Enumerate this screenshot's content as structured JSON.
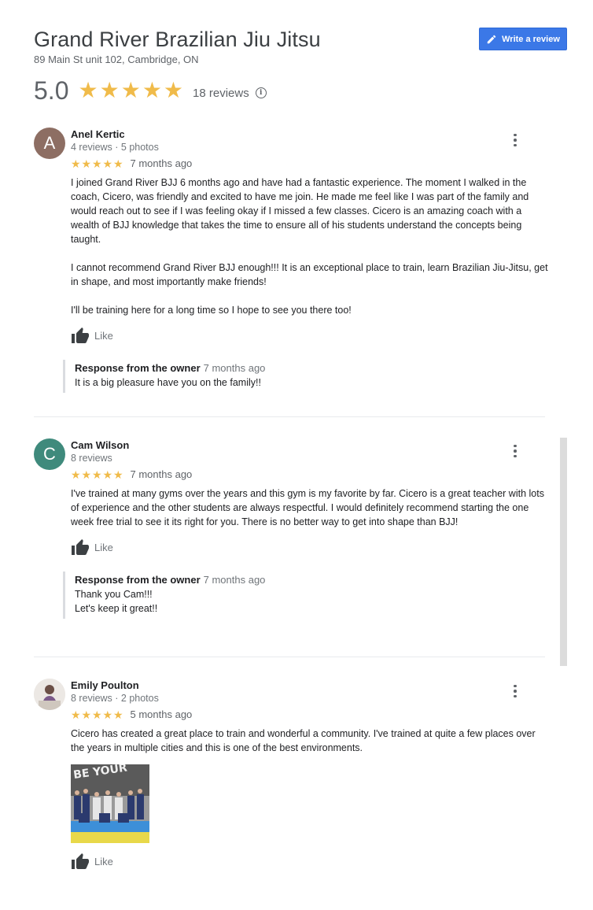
{
  "business": {
    "name": "Grand River Brazilian Jiu Jitsu",
    "address": "89 Main St unit 102, Cambridge, ON",
    "rating": "5.0",
    "review_count": "18 reviews",
    "write_review_label": "Write a review"
  },
  "colors": {
    "accent": "#3b78e7",
    "star": "#f0bb4a"
  },
  "reviews": [
    {
      "avatar_letter": "A",
      "avatar_color": "#8d6e63",
      "name": "Anel Kertic",
      "meta": "4 reviews · 5 photos",
      "stars": 5,
      "time": "7 months ago",
      "paragraphs": [
        "I joined Grand River BJJ 6 months ago and have had a fantastic experience. The moment I walked in the coach, Cicero, was friendly and excited to have me join. He made me feel like I was part of the family and would reach out to see if I was feeling okay if I missed a few classes. Cicero is an amazing coach with a wealth of BJJ knowledge that takes the time to ensure all of his students understand the concepts being taught.",
        "I cannot recommend Grand River BJJ enough!!! It is an exceptional place to train, learn Brazilian Jiu-Jitsu, get in shape, and most importantly make friends!",
        "I'll be training here for a long time so I hope to see you there too!"
      ],
      "like_label": "Like",
      "owner_label": "Response from the owner",
      "owner_time": "7 months ago",
      "owner_text": "It is a big pleasure have you on the family!!"
    },
    {
      "avatar_letter": "C",
      "avatar_color": "#3f8a7c",
      "name": "Cam Wilson",
      "meta": "8 reviews",
      "stars": 5,
      "time": "7 months ago",
      "paragraphs": [
        "I've trained at many gyms over the years and this gym is my favorite by far. Cicero is a great teacher with lots of experience and the other students are always respectful. I would definitely recommend starting the one week free trial to see it its right for you. There is no better way to get into shape than BJJ!"
      ],
      "like_label": "Like",
      "owner_label": "Response from the owner",
      "owner_time": "7 months ago",
      "owner_text": "Thank you Cam!!!\nLet's keep it great!!"
    },
    {
      "avatar_letter": "",
      "avatar_color": "#e9e6e3",
      "name": "Emily Poulton",
      "meta": "8 reviews · 2 photos",
      "stars": 5,
      "time": "5 months ago",
      "paragraphs": [
        "Cicero has created a great place to train and wonderful a community. I've trained at quite a few places over the years in multiple cities and this is one of the best environments."
      ],
      "photo_banner_text": "BE YOUR",
      "like_label": "Like"
    }
  ]
}
